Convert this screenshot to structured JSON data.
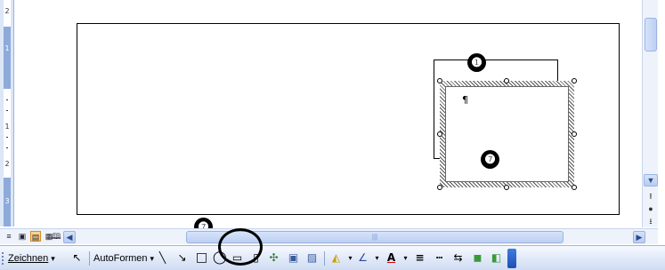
{
  "ruler": {
    "labels": [
      "2",
      "1",
      "1",
      "2",
      "3"
    ]
  },
  "document": {
    "paragraph_mark": "¶"
  },
  "callouts": {
    "shape_number": "❶",
    "textbox_number": "❼",
    "toolbar_number": "❼"
  },
  "scroll": {
    "up": "▲",
    "down": "▼",
    "prev_page": "⭱",
    "select_browse": "●",
    "next_page": "⭳",
    "left": "◀",
    "right": "▶",
    "thumb_grip": "|||"
  },
  "views": [
    "≡",
    "▣",
    "▤",
    "▦",
    "🕮"
  ],
  "toolbar": {
    "draw_label": "Zeichnen",
    "autoshapes_label": "AutoFormen",
    "dropdown_arrow": "▾",
    "cursor": "↖",
    "line": "╲",
    "arrow": "↘",
    "rectangle": "□",
    "oval": "◯",
    "textbox": "▭",
    "vertical_text": "▯",
    "diagram": "✣",
    "clipart": "▣",
    "picture": "▨",
    "fill": "◭",
    "line_color": "∠",
    "font_color": "A",
    "line_style": "≡",
    "dash_style": "┅",
    "arrow_style": "⇆",
    "shadow": "◼",
    "threed": "◧"
  },
  "colors": {
    "accent": "#d98b1e",
    "toolbar_bg": "#cfdcf3",
    "ruler_dark": "#8eaadb"
  }
}
